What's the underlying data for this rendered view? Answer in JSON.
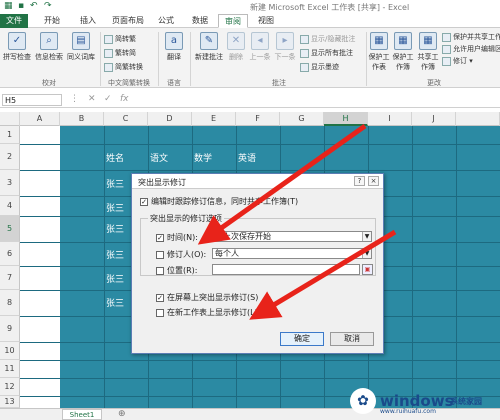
{
  "titlebar": {
    "title": "新建 Microsoft Excel 工作表 [共享] - Excel"
  },
  "tabs": [
    "文件",
    "开始",
    "插入",
    "页面布局",
    "公式",
    "数据",
    "审阅",
    "视图"
  ],
  "ribbon": {
    "proofing": {
      "spell": "拼写检查",
      "info": "信息检索",
      "thesaurus": "同义词库",
      "group": "校对"
    },
    "chinese": {
      "to_trad": "简转繁",
      "to_simp": "繁转简",
      "convert": "简繁转换",
      "group": "中文简繁转换"
    },
    "language": {
      "translate": "翻译",
      "group": "语言"
    },
    "comments": {
      "new": "新建批注",
      "delete": "删除",
      "prev": "上一条",
      "next": "下一条",
      "show_hide": "显示/隐藏批注",
      "show_all": "显示所有批注",
      "show_ink": "显示墨迹",
      "group": "批注"
    },
    "changes": {
      "protect_sheet": "保护工作表",
      "protect_wb": "保护工作簿",
      "share_wb": "共享工作簿",
      "protect_share": "保护并共享工作簿",
      "allow_edit": "允许用户编辑区域",
      "track": "修订",
      "group": "更改"
    }
  },
  "formula": {
    "namebox": "H5",
    "fx": "fx"
  },
  "columns": [
    "A",
    "B",
    "C",
    "D",
    "E",
    "F",
    "G",
    "H",
    "I",
    "J"
  ],
  "rows": [
    "1",
    "2",
    "3",
    "4",
    "5",
    "6",
    "7",
    "8",
    "9",
    "10",
    "11",
    "12",
    "13"
  ],
  "table": {
    "headers": [
      "姓名",
      "语文",
      "数学",
      "英语"
    ],
    "names": [
      "张三",
      "张三",
      "张三",
      "张三",
      "张三",
      "张三"
    ]
  },
  "dialog": {
    "title": "突出显示修订",
    "help": "?",
    "close": "×",
    "track_label": "编辑时跟踪修订信息，同时共享工作簿(T)",
    "group_label": "突出显示的修订选项",
    "when_label": "时间(N):",
    "when_value": "从上次保存开始",
    "who_label": "修订人(O):",
    "who_value": "每个人",
    "where_label": "位置(R):",
    "where_value": "",
    "screen_label": "在屏幕上突出显示修订(S)",
    "newsheet_label": "在新工作表上显示修订(L)",
    "ok": "确定",
    "cancel": "取消",
    "track_checked": true,
    "when_checked": true,
    "who_checked": false,
    "where_checked": false,
    "screen_checked": true,
    "newsheet_checked": false
  },
  "sheet_tab": "Sheet1",
  "watermark": {
    "brand": "windows",
    "suffix": "系统家园",
    "url": "www.ruihuafu.com"
  },
  "colors": {
    "excel_green": "#217346",
    "sheet_fill": "#2b8aa3",
    "arrow_red": "#e8231a"
  }
}
